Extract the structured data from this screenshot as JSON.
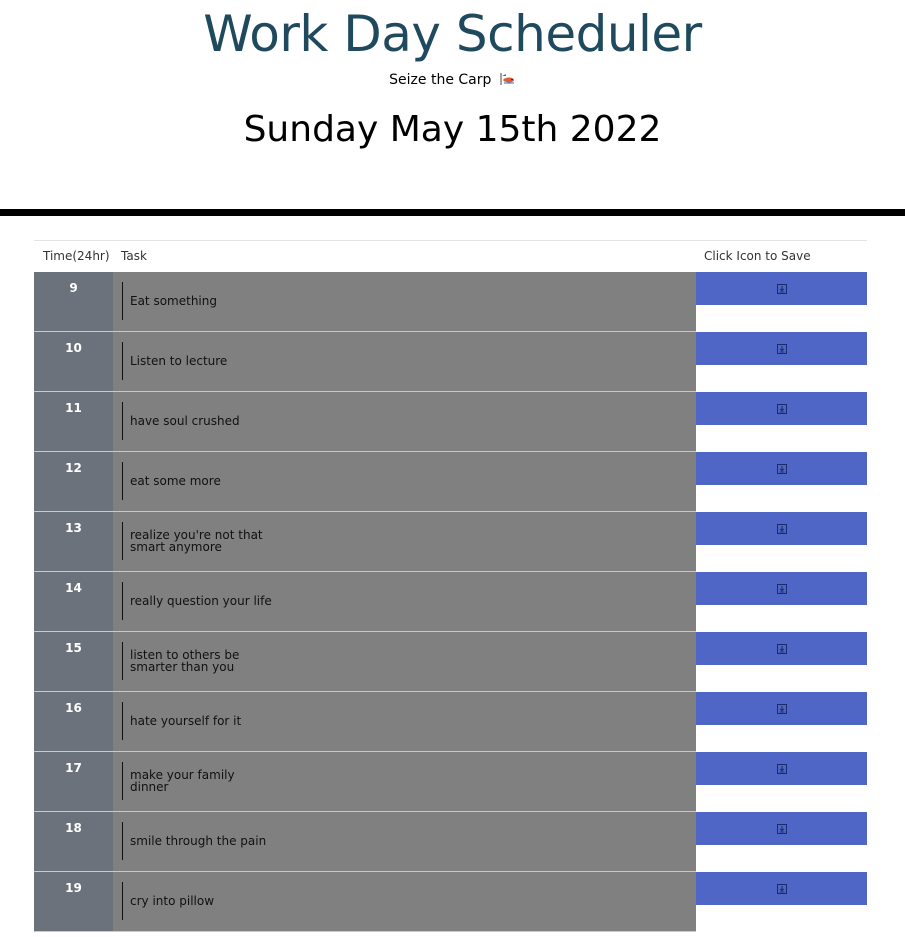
{
  "header": {
    "title": "Work Day Scheduler",
    "subtitle": "Seize the Carp",
    "date": "Sunday May 15th 2022"
  },
  "table": {
    "columns": [
      "Time(24hr)",
      "Task",
      "Click Icon to Save"
    ],
    "rows": [
      {
        "hour": "9",
        "task": "Eat something"
      },
      {
        "hour": "10",
        "task": "Listen to lecture"
      },
      {
        "hour": "11",
        "task": "have soul crushed"
      },
      {
        "hour": "12",
        "task": "eat some more"
      },
      {
        "hour": "13",
        "task": "realize you're not that\nsmart anymore"
      },
      {
        "hour": "14",
        "task": "really question your life"
      },
      {
        "hour": "15",
        "task": "listen to others be\nsmarter than you"
      },
      {
        "hour": "16",
        "task": "hate yourself for it"
      },
      {
        "hour": "17",
        "task": "make your family dinner"
      },
      {
        "hour": "18",
        "task": "smile through the pain"
      },
      {
        "hour": "19",
        "task": "cry into pillow"
      }
    ]
  },
  "icons": {
    "subtitle_icon": "fish-icon",
    "save_icon": "save-icon"
  },
  "colors": {
    "title": "#1f4a5e",
    "hour_cell": "#6b727c",
    "task_cell": "#808080",
    "save_button": "#4f66c6"
  }
}
